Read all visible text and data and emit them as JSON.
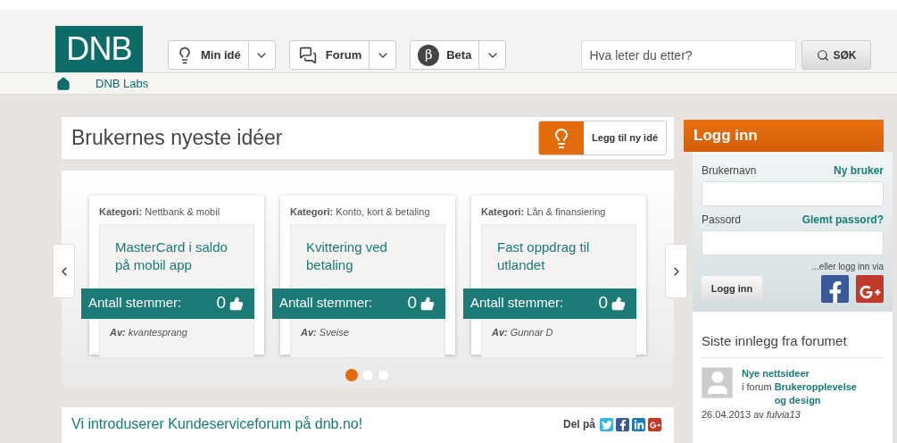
{
  "header": {
    "logo": "DNB",
    "nav": [
      {
        "kind": "bulb",
        "label": "Min idé"
      },
      {
        "kind": "chat",
        "label": "Forum"
      },
      {
        "kind": "symbol",
        "symbol": "β",
        "label": "Beta"
      }
    ],
    "search": {
      "placeholder": "Hva leter du etter?",
      "button": "SØK"
    }
  },
  "breadcrumb": {
    "items": [
      "DNB Labs"
    ]
  },
  "ideas": {
    "title": "Brukernes nyeste idéer",
    "add_button": "Legg til ny idé",
    "cards": [
      {
        "category_label": "Kategori:",
        "category": "Nettbank & mobil",
        "title": "MasterCard i saldo på mobil app",
        "votes_label": "Antall stemmer:",
        "votes": "0",
        "author_label": "Av:",
        "author": "kvantesprang"
      },
      {
        "category_label": "Kategori:",
        "category": "Konto, kort & betaling",
        "title": "Kvittering ved betaling",
        "votes_label": "Antall stemmer:",
        "votes": "0",
        "author_label": "Av:",
        "author": "Sveise"
      },
      {
        "category_label": "Kategori:",
        "category": "Lån & finansiering",
        "title": "Fast oppdrag til utlandet",
        "votes_label": "Antall stemmer:",
        "votes": "0",
        "author_label": "Av:",
        "author": "Gunnar D"
      }
    ],
    "dots": [
      {
        "selected": true
      },
      {
        "selected": false
      },
      {
        "selected": false
      }
    ]
  },
  "login": {
    "title": "Logg inn",
    "username_label": "Brukernavn",
    "new_user": "Ny bruker",
    "password_label": "Passord",
    "forgot": "Glemt passord?",
    "alt_text": "...eller logg inn via",
    "button": "Logg inn",
    "social": [
      {
        "kind": "facebook"
      },
      {
        "kind": "googleplus"
      }
    ]
  },
  "forum": {
    "heading": "Siste innlegg fra forumet",
    "posts": [
      {
        "title": "Nye nettsideer",
        "in_label": "i forum",
        "forum": "Brukeropplevelse og design",
        "date": "26.04.2013",
        "by": "av",
        "author": "fulvia13"
      }
    ]
  },
  "news": {
    "headline": "Vi introduserer Kundeserviceforum på dnb.no!",
    "share_label": "Del på",
    "share": [
      {
        "kind": "twitter"
      },
      {
        "kind": "facebook"
      },
      {
        "kind": "linkedin"
      },
      {
        "kind": "googleplus"
      }
    ]
  }
}
